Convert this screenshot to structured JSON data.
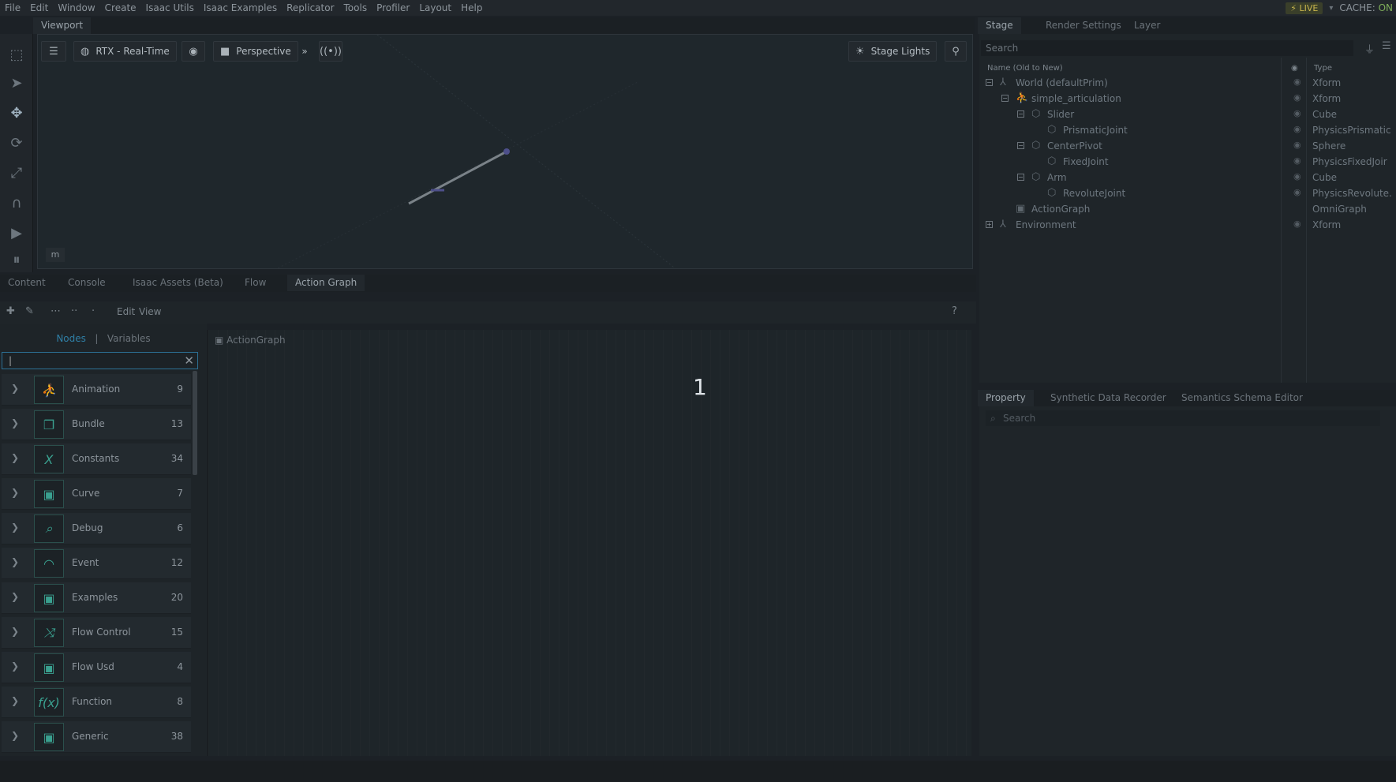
{
  "menu": [
    "File",
    "Edit",
    "Window",
    "Create",
    "Isaac Utils",
    "Isaac Examples",
    "Replicator",
    "Tools",
    "Profiler",
    "Layout",
    "Help"
  ],
  "status": {
    "live": "LIVE",
    "cache_label": "CACHE:",
    "cache_value": "ON"
  },
  "viewport": {
    "tab": "Viewport",
    "renderer": "RTX - Real-Time",
    "camera": "Perspective",
    "stage_lights": "Stage Lights",
    "units": "m"
  },
  "lower_tabs": [
    "Content",
    "Console",
    "Isaac Assets (Beta)",
    "Flow",
    "Action Graph"
  ],
  "graph_toolbar": {
    "edit": "Edit",
    "view": "View",
    "help": "?"
  },
  "nodes_panel": {
    "tab_nodes": "Nodes",
    "separator": "|",
    "tab_variables": "Variables",
    "search_value": "|",
    "categories": [
      {
        "name": "Animation",
        "count": "9",
        "icon": "animation-icon",
        "glyph": "⛹"
      },
      {
        "name": "Bundle",
        "count": "13",
        "icon": "bundle-icon",
        "glyph": "❐"
      },
      {
        "name": "Constants",
        "count": "34",
        "icon": "constants-icon",
        "glyph": "X"
      },
      {
        "name": "Curve",
        "count": "7",
        "icon": "curve-icon",
        "glyph": "▣"
      },
      {
        "name": "Debug",
        "count": "6",
        "icon": "debug-icon",
        "glyph": "⌕"
      },
      {
        "name": "Event",
        "count": "12",
        "icon": "event-icon",
        "glyph": "◠"
      },
      {
        "name": "Examples",
        "count": "20",
        "icon": "examples-icon",
        "glyph": "▣"
      },
      {
        "name": "Flow Control",
        "count": "15",
        "icon": "flow-control-icon",
        "glyph": "⤨"
      },
      {
        "name": "Flow Usd",
        "count": "4",
        "icon": "flow-usd-icon",
        "glyph": "▣"
      },
      {
        "name": "Function",
        "count": "8",
        "icon": "function-icon",
        "glyph": "f(x)"
      },
      {
        "name": "Generic",
        "count": "38",
        "icon": "generic-icon",
        "glyph": "▣"
      }
    ]
  },
  "graph": {
    "title": "ActionGraph",
    "overlay_number": "1"
  },
  "stage": {
    "tabs": [
      "Stage",
      "Render Settings",
      "Layer"
    ],
    "search_placeholder": "Search",
    "col_name": "Name (Old to New)",
    "col_type": "Type",
    "rows": [
      {
        "name": "World (defaultPrim)",
        "type": "Xform"
      },
      {
        "name": "simple_articulation",
        "type": "Xform"
      },
      {
        "name": "Slider",
        "type": "Cube"
      },
      {
        "name": "PrismaticJoint",
        "type": "PhysicsPrismatic"
      },
      {
        "name": "CenterPivot",
        "type": "Sphere"
      },
      {
        "name": "FixedJoint",
        "type": "PhysicsFixedJoir"
      },
      {
        "name": "Arm",
        "type": "Cube"
      },
      {
        "name": "RevoluteJoint",
        "type": "PhysicsRevolute."
      },
      {
        "name": "ActionGraph",
        "type": "OmniGraph"
      },
      {
        "name": "Environment",
        "type": "Xform"
      }
    ]
  },
  "property": {
    "tabs": [
      "Property",
      "Synthetic Data Recorder",
      "Semantics Schema Editor"
    ],
    "search_placeholder": "Search"
  }
}
